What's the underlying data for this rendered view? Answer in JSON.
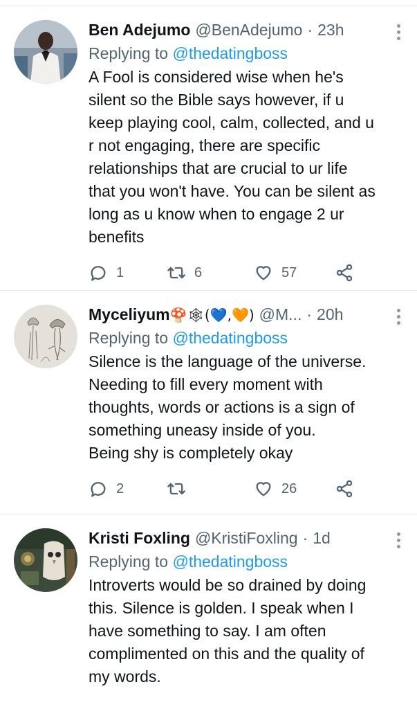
{
  "tweets": [
    {
      "name": "Ben Adejumo",
      "handle": "@BenAdejumo",
      "separator": "·",
      "time": "23h",
      "replying_prefix": "Replying to ",
      "replying_handle": "@thedatingboss",
      "text": "A Fool is considered wise when he's\nsilent so the Bible says however, if u\nkeep playing cool, calm, collected, and u\nr not engaging, there are specific\nrelationships that are crucial to ur life\nthat you won't have. You can be silent as\nlong as u know when to engage 2 ur\nbenefits",
      "replies": "1",
      "retweets": "6",
      "likes": "57"
    },
    {
      "name": "Myceliyum",
      "name_emoji": "🍄🕸(💙,🧡)",
      "handle": "@M...",
      "separator": "·",
      "time": "20h",
      "replying_prefix": "Replying to ",
      "replying_handle": "@thedatingboss",
      "text": "Silence is the language of the universe.\nNeeding to fill every moment with\nthoughts, words or actions is a sign of\nsomething uneasy inside of you.\nBeing shy is completely okay",
      "replies": "2",
      "retweets": "",
      "likes": "26"
    },
    {
      "name": "Kristi Foxling",
      "handle": "@KristiFoxling",
      "separator": "·",
      "time": "1d",
      "replying_prefix": "Replying to ",
      "replying_handle": "@thedatingboss",
      "text": "Introverts would be so drained by doing\nthis. Silence is golden. I speak when I\nhave something to say. I am often\ncomplimented on this and the quality of\nmy words."
    }
  ],
  "icons": {
    "reply": "reply-icon",
    "retweet": "retweet-icon",
    "like": "heart-icon",
    "share": "share-icon",
    "more": "more-vertical-icon"
  },
  "colors": {
    "link": "#1d9bf0",
    "secondary_text": "#536471",
    "primary_text": "#0f1419",
    "divider": "#e6ecf0"
  }
}
